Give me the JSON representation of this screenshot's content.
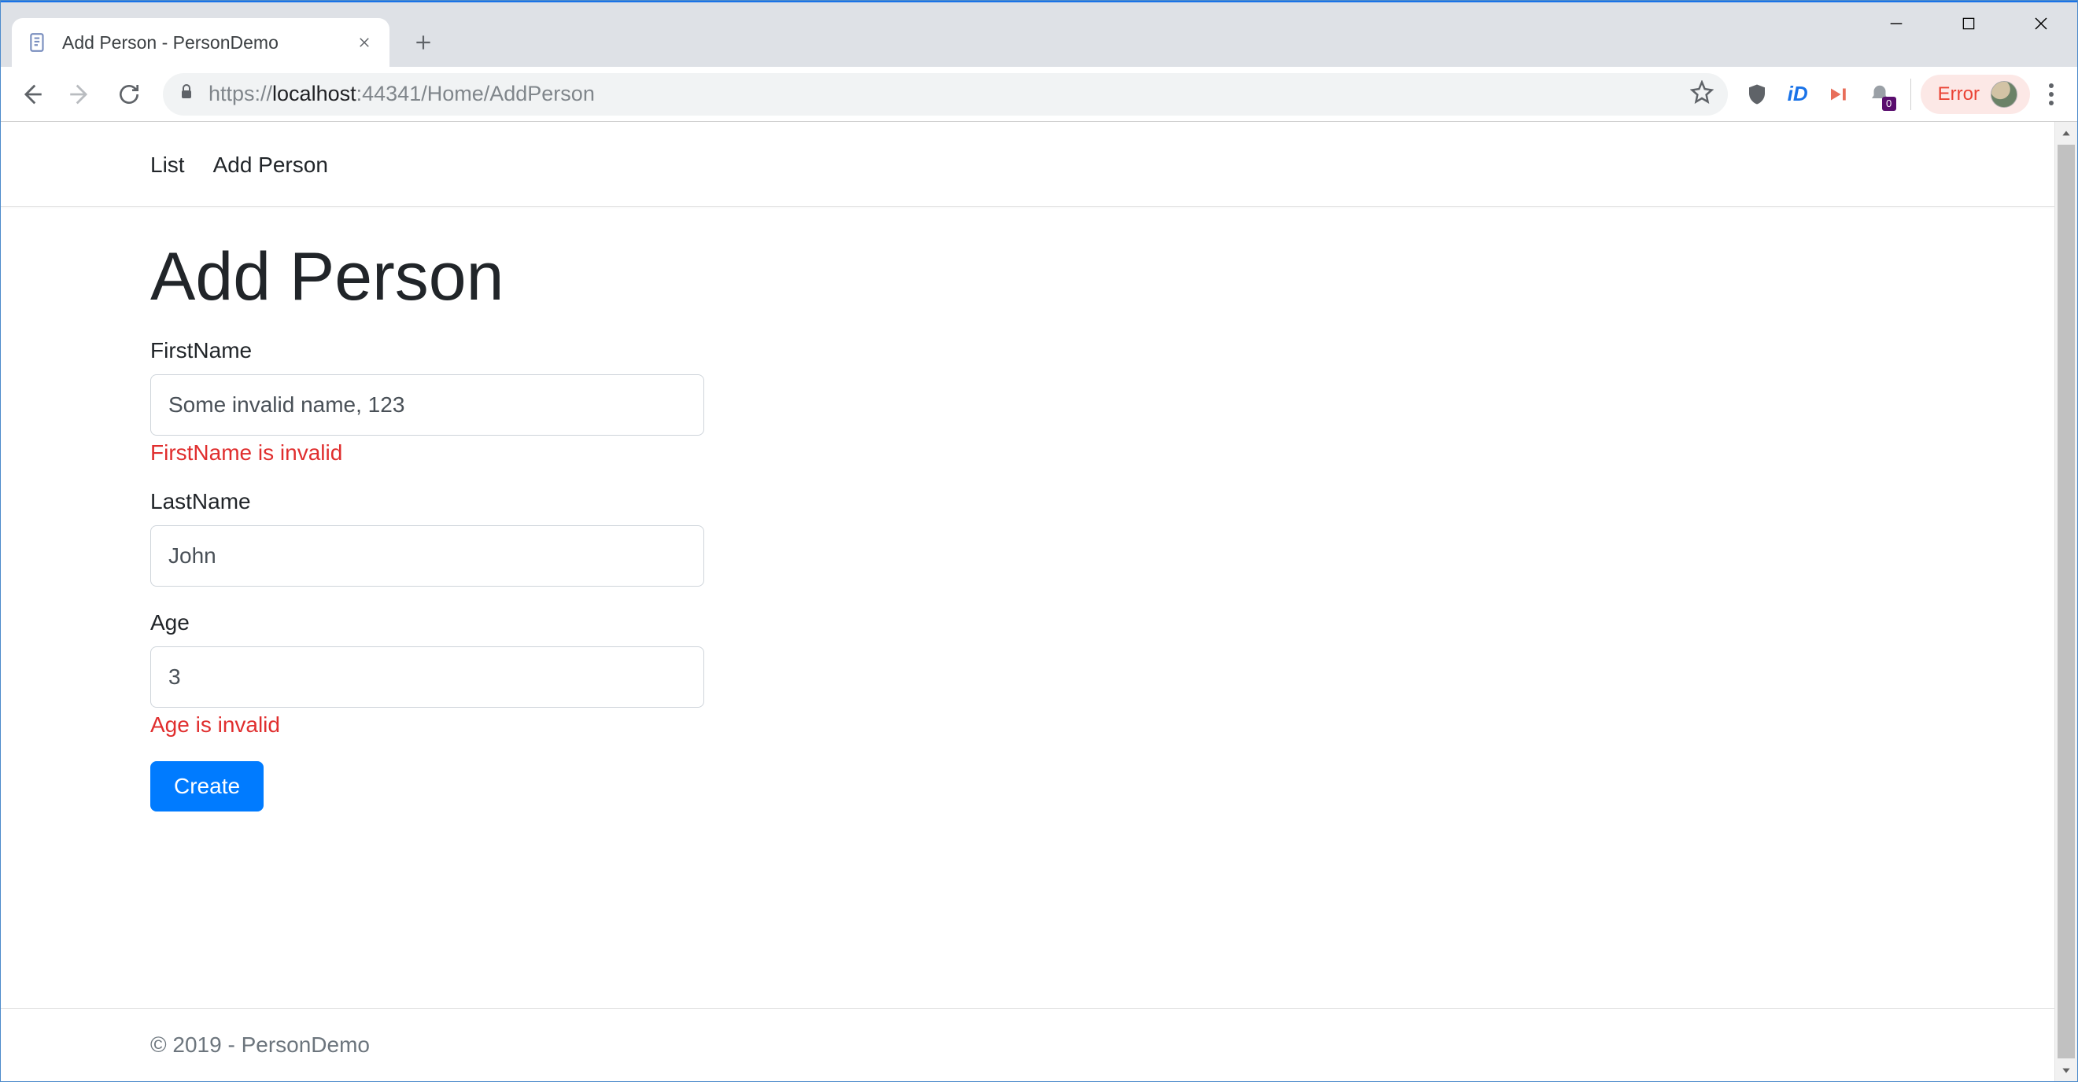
{
  "browser": {
    "tab_title": "Add Person - PersonDemo",
    "url_scheme": "https://",
    "url_host": "localhost",
    "url_port": ":44341",
    "url_path": "/Home/AddPerson",
    "error_chip_label": "Error",
    "badge_count": "0"
  },
  "nav": {
    "items": [
      {
        "label": "List"
      },
      {
        "label": "Add Person"
      }
    ]
  },
  "page": {
    "title": "Add Person"
  },
  "form": {
    "firstname": {
      "label": "FirstName",
      "value": "Some invalid name, 123",
      "error": "FirstName is invalid"
    },
    "lastname": {
      "label": "LastName",
      "value": "John"
    },
    "age": {
      "label": "Age",
      "value": "3",
      "error": "Age is invalid"
    },
    "submit_label": "Create"
  },
  "footer": {
    "text": "© 2019 - PersonDemo"
  }
}
